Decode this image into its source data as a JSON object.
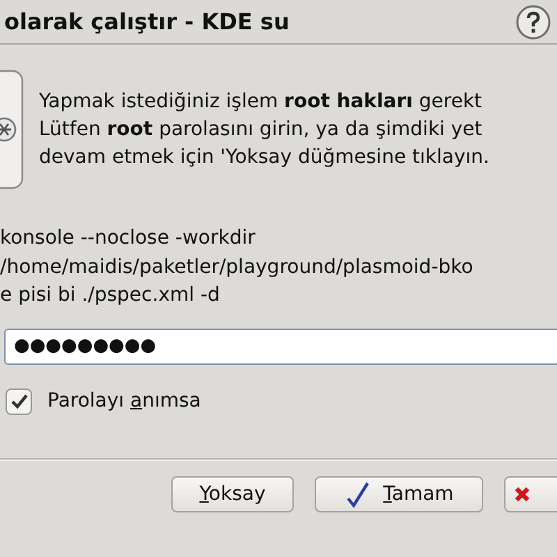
{
  "window": {
    "title": "olarak çalıştır - KDE su"
  },
  "message": [
    "Yapmak istediğiniz işlem **root hakları** gerekt",
    "Lütfen **root** parolasını girin, ya da şimdiki yet",
    "devam etmek için 'Yoksay düğmesine tıklayın."
  ],
  "command": [
    "konsole --noclose -workdir",
    "/home/maidis/paketler/playground/plasmoid-bko",
    "e pisi bi ./pspec.xml -d"
  ],
  "password": {
    "value": "●●●●●●●●●"
  },
  "remember": {
    "label": {
      "pre": "Parolayı ",
      "key": "a",
      "post": "nımsa"
    },
    "checked": true
  },
  "buttons": [
    {
      "kind": "text",
      "label": {
        "key": "Y",
        "post": "oksay"
      }
    },
    {
      "kind": "ok",
      "label": {
        "key": "T",
        "post": "amam"
      }
    },
    {
      "kind": "cancel"
    }
  ]
}
